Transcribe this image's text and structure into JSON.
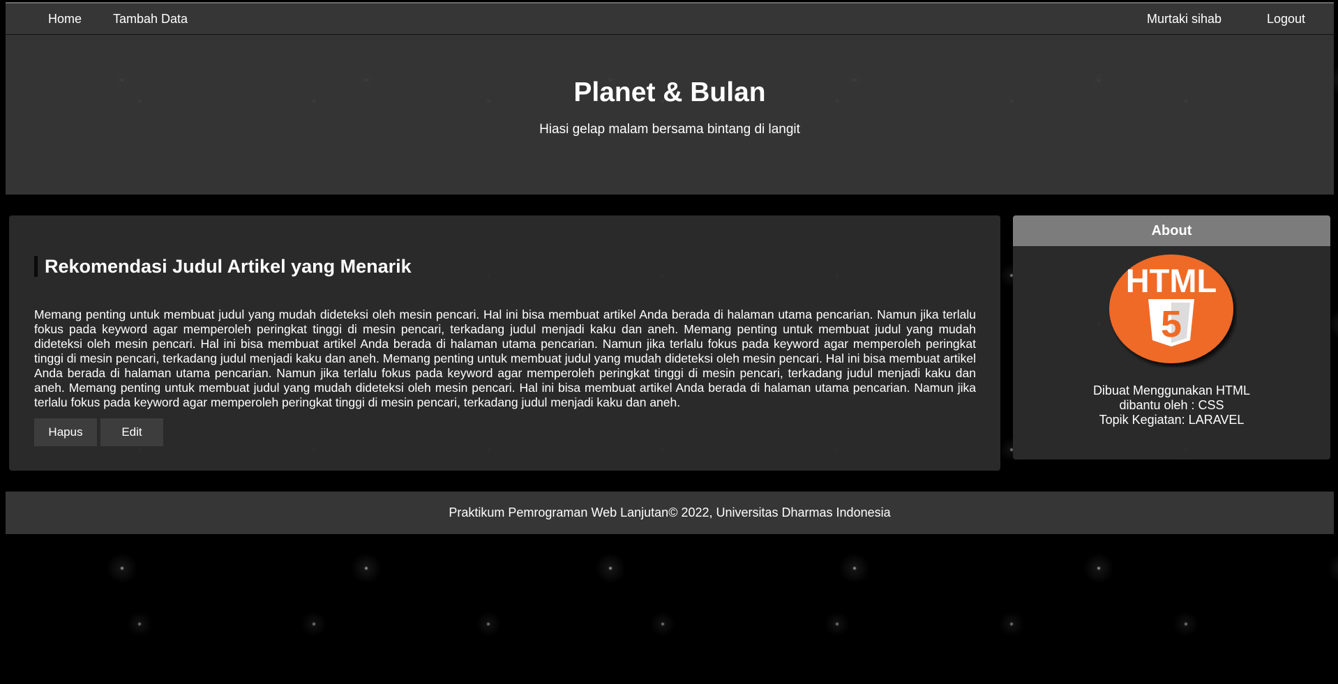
{
  "nav": {
    "home": "Home",
    "add_data": "Tambah Data",
    "user": "Murtaki sihab",
    "logout": "Logout"
  },
  "header": {
    "title": "Planet & Bulan",
    "subtitle": "Hiasi gelap malam bersama bintang di langit"
  },
  "article": {
    "title": "Rekomendasi Judul Artikel yang Menarik",
    "body": "Memang penting untuk membuat judul yang mudah dideteksi oleh mesin pencari. Hal ini bisa membuat artikel Anda berada di halaman utama pencarian. Namun jika terlalu fokus pada keyword agar memperoleh peringkat tinggi di mesin pencari, terkadang judul menjadi kaku dan aneh. Memang penting untuk membuat judul yang mudah dideteksi oleh mesin pencari. Hal ini bisa membuat artikel Anda berada di halaman utama pencarian. Namun jika terlalu fokus pada keyword agar memperoleh peringkat tinggi di mesin pencari, terkadang judul menjadi kaku dan aneh. Memang penting untuk membuat judul yang mudah dideteksi oleh mesin pencari. Hal ini bisa membuat artikel Anda berada di halaman utama pencarian. Namun jika terlalu fokus pada keyword agar memperoleh peringkat tinggi di mesin pencari, terkadang judul menjadi kaku dan aneh. Memang penting untuk membuat judul yang mudah dideteksi oleh mesin pencari. Hal ini bisa membuat artikel Anda berada di halaman utama pencarian. Namun jika terlalu fokus pada keyword agar memperoleh peringkat tinggi di mesin pencari, terkadang judul menjadi kaku dan aneh.",
    "delete_label": "Hapus",
    "edit_label": "Edit"
  },
  "sidebar": {
    "title": "About",
    "logo": {
      "icon": "html5-logo-icon",
      "text": "HTML",
      "number": "5"
    },
    "lines": [
      "Dibuat Menggunakan HTML",
      "dibantu oleh : CSS",
      "Topik Kegiatan: LARAVEL"
    ]
  },
  "footer": {
    "text": "Praktikum Pemrograman Web Lanjutan© 2022, Universitas Dharmas Indonesia"
  },
  "colors": {
    "page_background": "#000000",
    "bar_background": "#363636",
    "panel_background": "#2c2c2c",
    "sidebar_title_background": "#7c7c7c",
    "html5_orange": "#ef6a26",
    "text": "#ffffff"
  }
}
